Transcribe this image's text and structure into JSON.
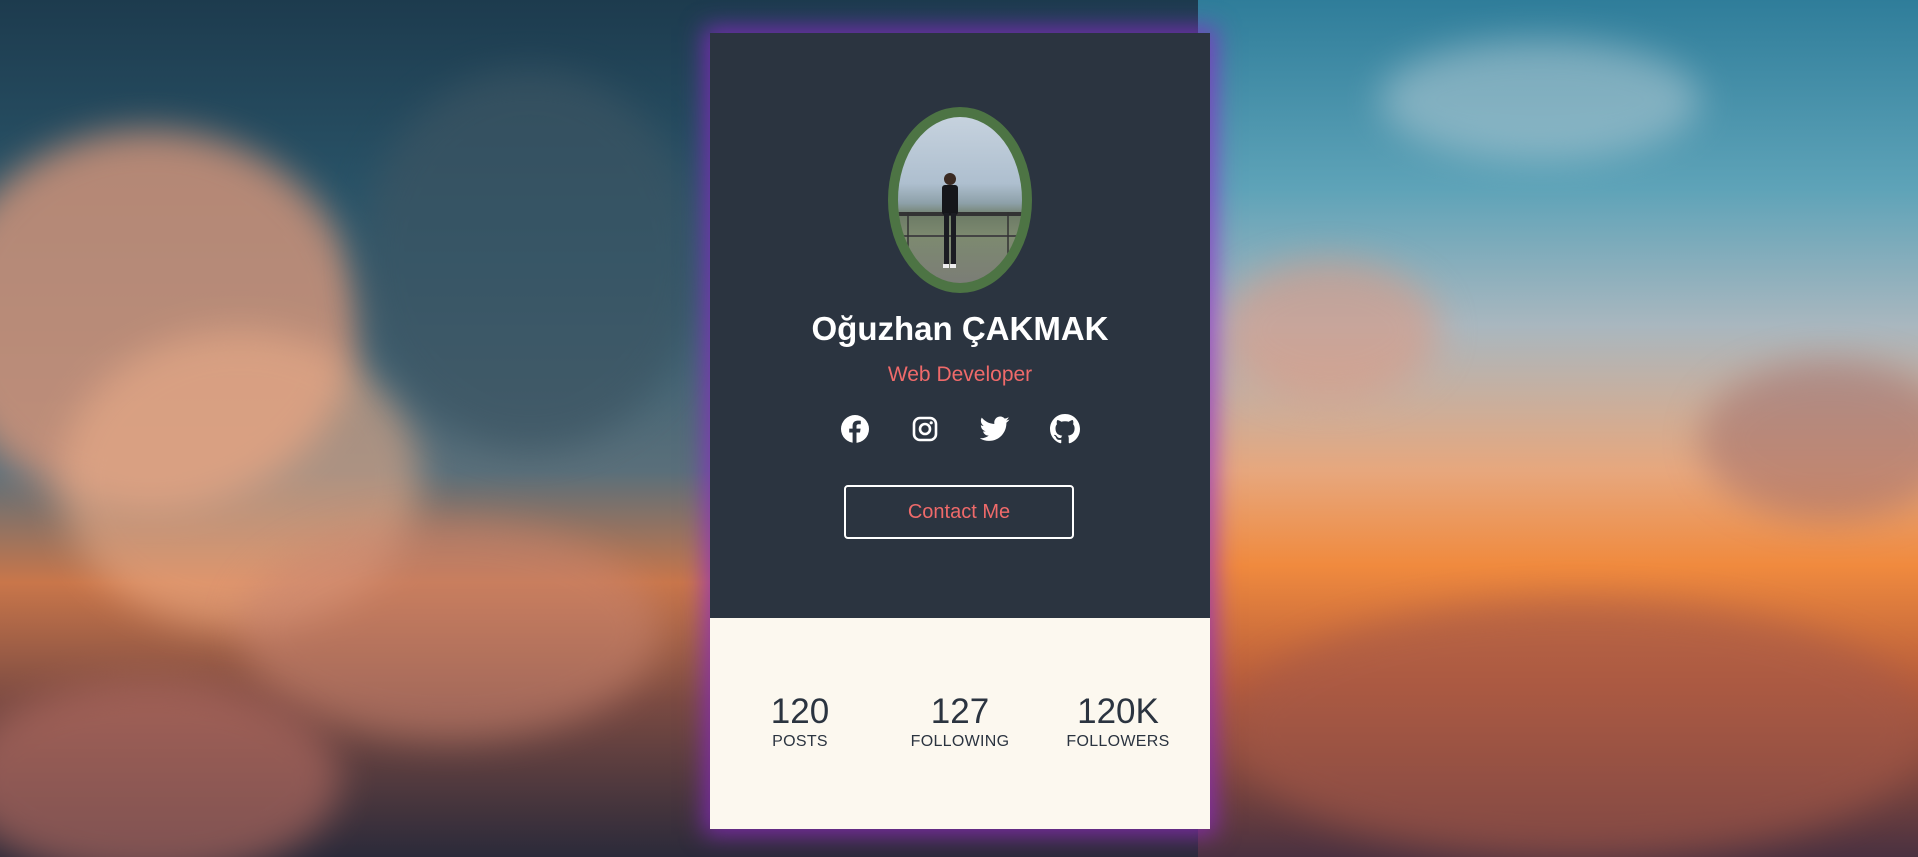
{
  "profile": {
    "name": "Oğuzhan ÇAKMAK",
    "role": "Web Developer",
    "contact_label": "Contact Me"
  },
  "socials": [
    {
      "icon": "facebook-icon"
    },
    {
      "icon": "instagram-icon"
    },
    {
      "icon": "twitter-icon"
    },
    {
      "icon": "github-icon"
    }
  ],
  "stats": [
    {
      "value": "120",
      "label": "POSTS"
    },
    {
      "value": "127",
      "label": "FOLLOWING"
    },
    {
      "value": "120K",
      "label": "FOLLOWERS"
    }
  ],
  "colors": {
    "card_dark": "#2b3440",
    "card_light": "#fcf8ef",
    "accent": "#ef6a6a",
    "avatar_ring": "#4d7444",
    "glow": "#8c28c8"
  }
}
